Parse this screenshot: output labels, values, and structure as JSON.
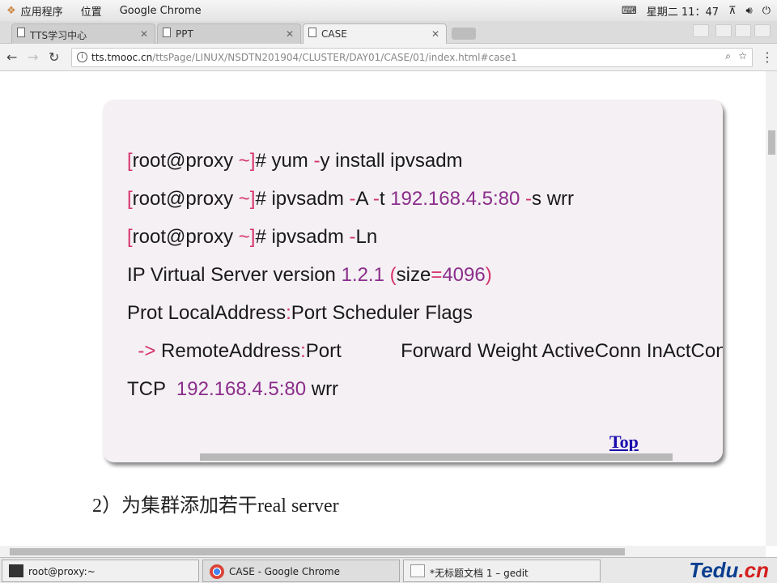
{
  "topbar": {
    "apps": "应用程序",
    "places": "位置",
    "app_name": "Google Chrome",
    "clock": "星期二 11：47"
  },
  "tabs": [
    {
      "label": "TTS学习中心"
    },
    {
      "label": "PPT"
    },
    {
      "label": "CASE",
      "active": true
    }
  ],
  "address": {
    "host": "tts.tmooc.cn",
    "path": "/ttsPage/LINUX/NSDTN201904/CLUSTER/DAY01/CASE/01/index.html#case1"
  },
  "code_lines": [
    [
      [
        "r",
        "["
      ],
      [
        "",
        "root@proxy "
      ],
      [
        "r",
        "~"
      ],
      [
        "r",
        "]"
      ],
      [
        "",
        "# yum "
      ],
      [
        "r",
        "-"
      ],
      [
        "",
        "y install ipvsadm"
      ]
    ],
    [
      [
        "r",
        "["
      ],
      [
        "",
        "root@proxy "
      ],
      [
        "r",
        "~"
      ],
      [
        "r",
        "]"
      ],
      [
        "",
        "# ipvsadm "
      ],
      [
        "r",
        "-"
      ],
      [
        "",
        "A "
      ],
      [
        "r",
        "-"
      ],
      [
        "",
        "t "
      ],
      [
        "p",
        "192.168.4.5:80"
      ],
      [
        "",
        ""
      ],
      [
        "r",
        " -"
      ],
      [
        "",
        "s wrr"
      ]
    ],
    [
      [
        "r",
        "["
      ],
      [
        "",
        "root@proxy "
      ],
      [
        "r",
        "~"
      ],
      [
        "r",
        "]"
      ],
      [
        "",
        "# ipvsadm "
      ],
      [
        "r",
        "-"
      ],
      [
        "",
        "Ln"
      ]
    ],
    [
      [
        "",
        "IP Virtual Server version "
      ],
      [
        "p",
        "1.2.1"
      ],
      [
        "r",
        " ("
      ],
      [
        "",
        "size"
      ],
      [
        "r",
        "="
      ],
      [
        "p",
        "4096"
      ],
      [
        "r",
        ")"
      ]
    ],
    [
      [
        "",
        "Prot LocalAddress"
      ],
      [
        "r",
        ":"
      ],
      [
        "",
        "Port Scheduler Flags"
      ]
    ],
    [
      [
        "r",
        "  ->"
      ],
      [
        "",
        " RemoteAddress"
      ],
      [
        "r",
        ":"
      ],
      [
        "",
        "Port           Forward Weight ActiveConn InActConn"
      ]
    ],
    [
      [
        "",
        "TCP  "
      ],
      [
        "p",
        "192.168.4.5:80"
      ],
      [
        "",
        " wrr"
      ]
    ]
  ],
  "top_link": "Top",
  "step_heading": "2）为集群添加若干real server",
  "taskbar": [
    {
      "label": "root@proxy:~"
    },
    {
      "label": "CASE - Google Chrome",
      "active": true
    },
    {
      "label": "*无标题文档 1 – gedit"
    }
  ],
  "logo": "Tedu.cn",
  "colors": {
    "punct": "#d6336c",
    "number": "#8b2d8b",
    "link": "#1a0dab"
  }
}
